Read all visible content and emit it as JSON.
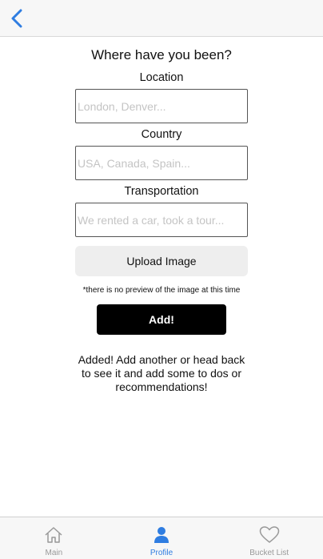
{
  "nav": {
    "back_icon": "chevron-left-icon"
  },
  "form": {
    "title": "Where have you been?",
    "location": {
      "label": "Location",
      "placeholder": "London, Denver...",
      "value": ""
    },
    "country": {
      "label": "Country",
      "placeholder": "USA, Canada, Spain...",
      "value": ""
    },
    "transportation": {
      "label": "Transportation",
      "placeholder": "We rented a car, took a tour...",
      "value": ""
    },
    "upload_label": "Upload Image",
    "note": "*there is no preview of the image at this time",
    "add_label": "Add!",
    "status_message": "Added! Add another or head back to see it and add some to dos or recommendations!"
  },
  "tabs": [
    {
      "label": "Main",
      "icon": "home-icon",
      "active": false
    },
    {
      "label": "Profile",
      "icon": "person-icon",
      "active": true
    },
    {
      "label": "Bucket List",
      "icon": "heart-icon",
      "active": false
    }
  ],
  "colors": {
    "accent": "#2f7de1",
    "inactive": "#999999",
    "add_button": "#000000",
    "upload_button": "#eeeeee"
  }
}
